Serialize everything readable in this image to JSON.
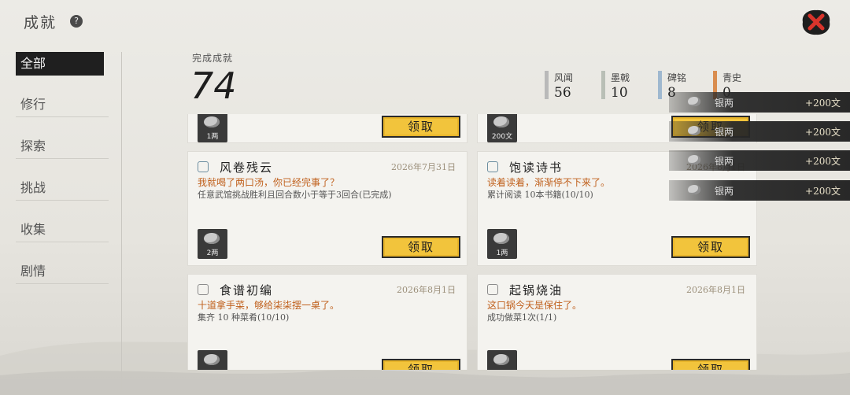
{
  "header": {
    "title": "成就",
    "help_icon": "?"
  },
  "sidebar": {
    "items": [
      {
        "label": "全部",
        "active": true
      },
      {
        "label": "修行"
      },
      {
        "label": "探索"
      },
      {
        "label": "挑战"
      },
      {
        "label": "收集"
      },
      {
        "label": "剧情"
      }
    ]
  },
  "summary": {
    "completed_label": "完成成就",
    "completed_count": "74",
    "categories": [
      {
        "label": "风闻",
        "value": "56",
        "color": "#b9b9b9"
      },
      {
        "label": "墨戟",
        "value": "10",
        "color": "#b9bfb6"
      },
      {
        "label": "碑铭",
        "value": "8",
        "color": "#9fb8cf"
      },
      {
        "label": "青史",
        "value": "0",
        "color": "#d98d4f"
      }
    ]
  },
  "cards": [
    {
      "title": "",
      "date": "",
      "quote": "",
      "desc": "",
      "reward_qty": "1两",
      "claim": "领取"
    },
    {
      "title": "",
      "date": "",
      "quote": "",
      "desc": "",
      "reward_qty": "200文",
      "claim": "领取"
    },
    {
      "title": "风卷残云",
      "date": "2026年7月31日",
      "quote": "我就喝了两口汤，你已经完事了？",
      "desc": "任意武馆挑战胜利且回合数小于等于3回合(已完成)",
      "reward_qty": "2两",
      "claim": "领取"
    },
    {
      "title": "饱读诗书",
      "date": "2026年8月1日",
      "quote": "读着读着，渐渐停不下来了。",
      "desc": "累计阅读 10本书籍(10/10)",
      "reward_qty": "1两",
      "claim": "领取"
    },
    {
      "title": "食谱初编",
      "date": "2026年8月1日",
      "quote": "十道拿手菜，够给柒柒摆一桌了。",
      "desc": "集齐 10 种菜肴(10/10)",
      "reward_qty": "",
      "claim": "领取"
    },
    {
      "title": "起锅烧油",
      "date": "2026年8月1日",
      "quote": "这口锅今天是保住了。",
      "desc": "成功做菜1次(1/1)",
      "reward_qty": "",
      "claim": "领取"
    }
  ],
  "toasts": [
    {
      "name": "银两",
      "amount": "+200文"
    },
    {
      "name": "银两",
      "amount": "+200文"
    },
    {
      "name": "银两",
      "amount": "+200文"
    },
    {
      "name": "银两",
      "amount": "+200文"
    }
  ],
  "colors": {
    "claim_bg": "#f2c43c",
    "quote": "#c0601c",
    "date": "#9b8f7a"
  }
}
